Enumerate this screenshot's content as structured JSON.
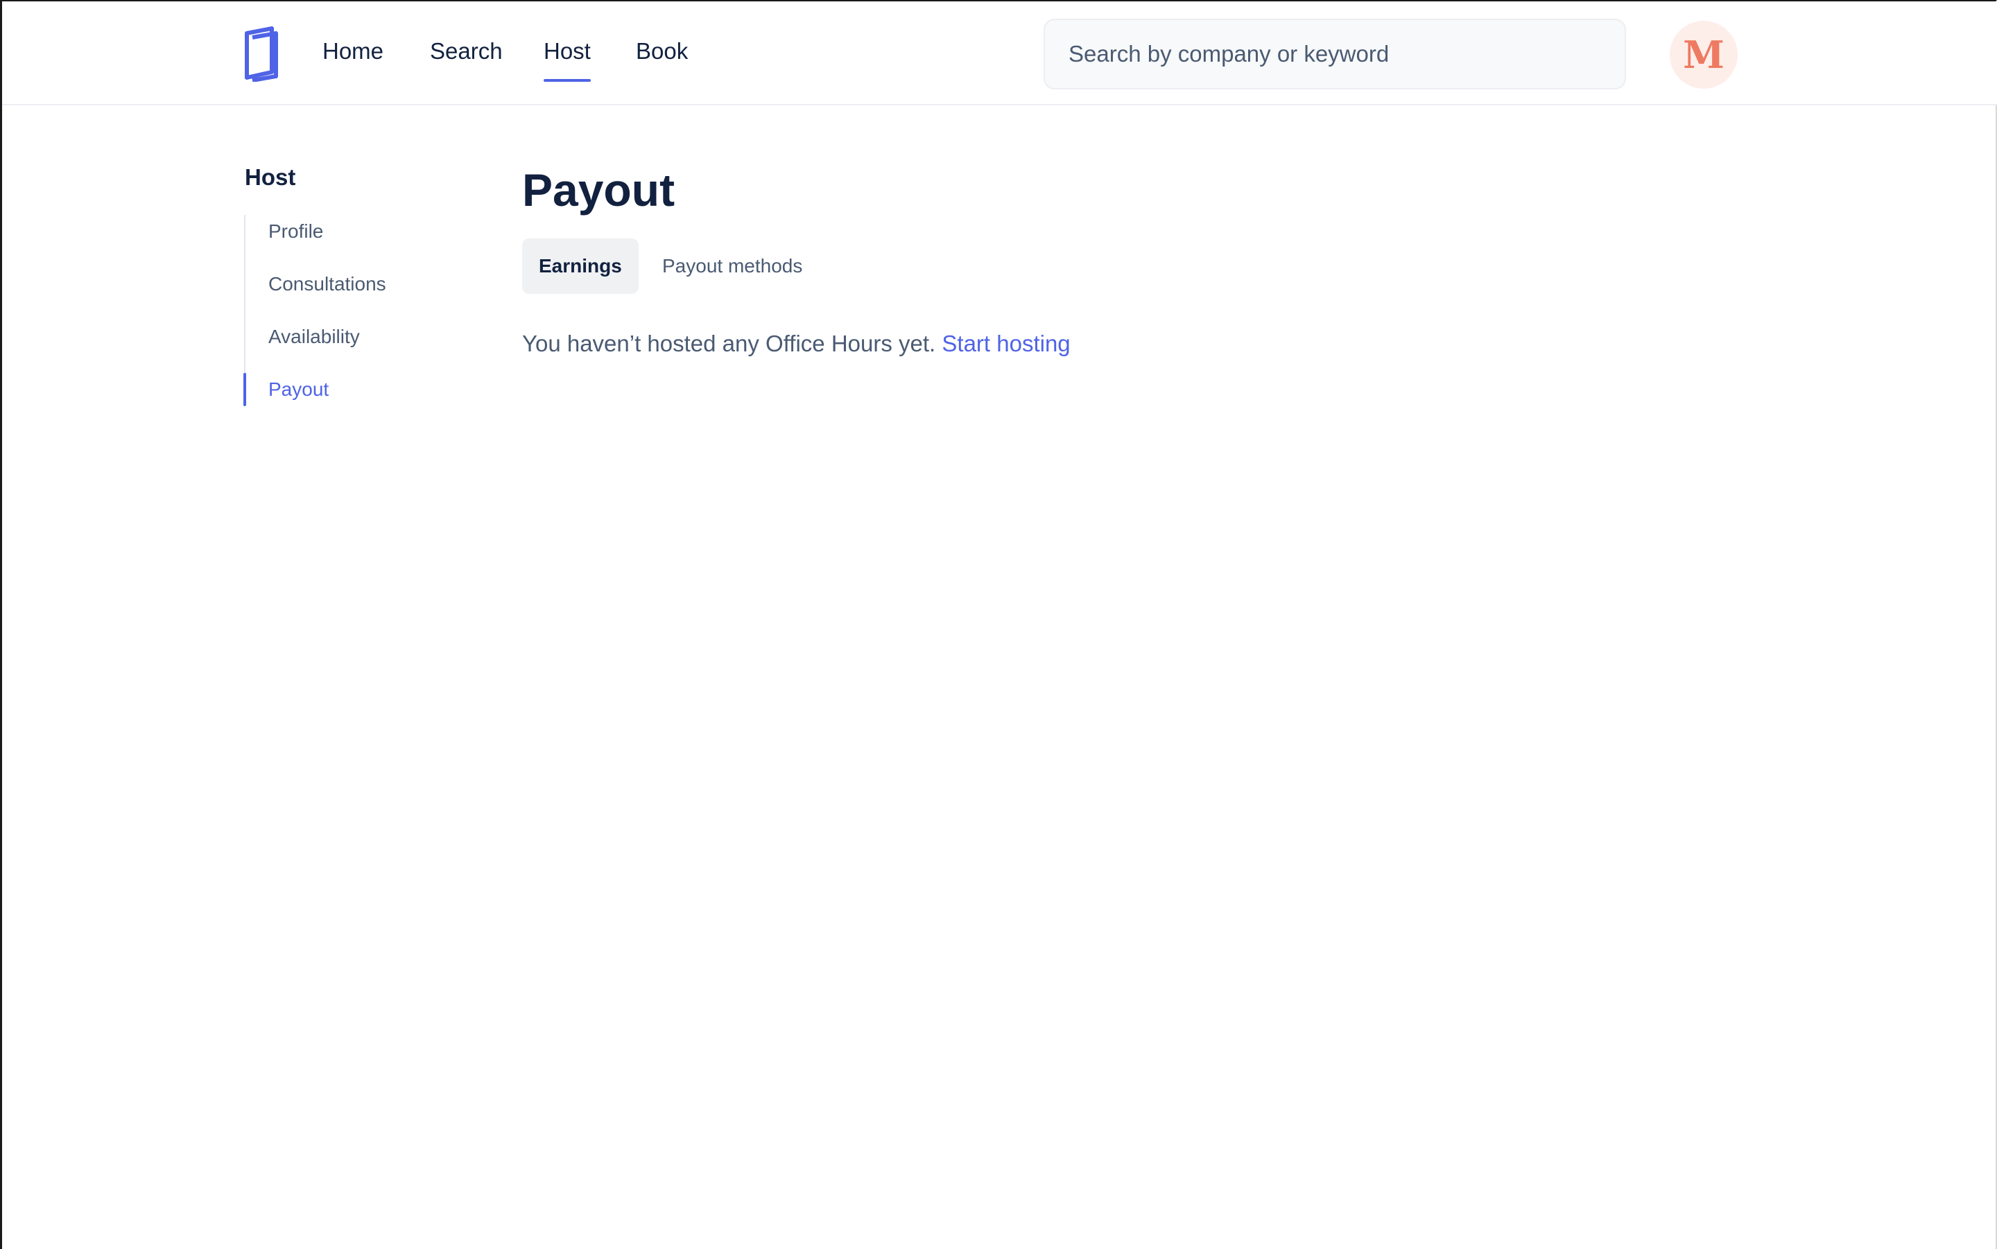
{
  "header": {
    "nav": [
      {
        "label": "Home",
        "active": false
      },
      {
        "label": "Search",
        "active": false
      },
      {
        "label": "Host",
        "active": true
      },
      {
        "label": "Book",
        "active": false
      }
    ],
    "search": {
      "placeholder": "Search by company or keyword",
      "value": ""
    },
    "avatar": {
      "initial": "M"
    },
    "logo_icon": "book-logo-icon"
  },
  "sidebar": {
    "title": "Host",
    "items": [
      {
        "label": "Profile",
        "active": false
      },
      {
        "label": "Consultations",
        "active": false
      },
      {
        "label": "Availability",
        "active": false
      },
      {
        "label": "Payout",
        "active": true
      }
    ]
  },
  "main": {
    "title": "Payout",
    "tabs": [
      {
        "label": "Earnings",
        "active": true
      },
      {
        "label": "Payout methods",
        "active": false
      }
    ],
    "empty_state": {
      "message": "You haven’t hosted any Office Hours yet.",
      "link_label": "Start hosting"
    }
  },
  "colors": {
    "accent": "#4f63e6",
    "text_dark": "#12213f",
    "text_muted": "#4a5a72",
    "avatar_bg": "#fdeeea",
    "avatar_fg": "#ee7a62"
  }
}
